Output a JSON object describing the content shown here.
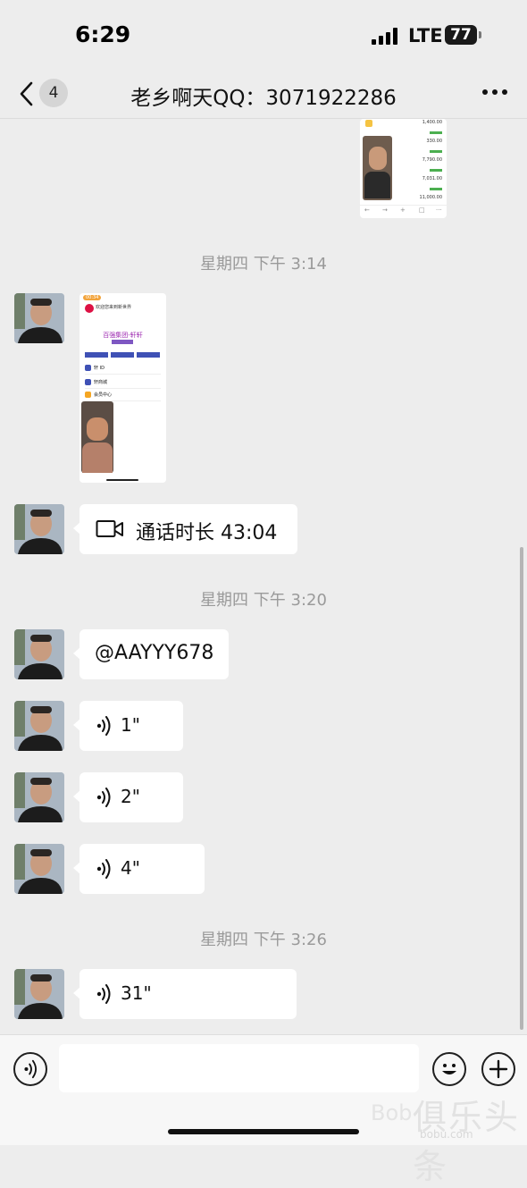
{
  "status_bar": {
    "time": "6:29",
    "network": "LTE",
    "battery": "77"
  },
  "nav": {
    "back_count": "4",
    "title": "老乡啊天QQ：3071922286"
  },
  "timestamps": [
    "星期四 下午 3:14",
    "星期四 下午 3:20",
    "星期四 下午 3:26"
  ],
  "messages": {
    "call": "通话时长 43:04",
    "mention": "@AAYYY678",
    "voice": [
      "1\"",
      "2\"",
      "4\"",
      "31\""
    ]
  },
  "shot1": {
    "amounts": [
      "1,400.00",
      "330.00",
      "7,790.00",
      "7,031.00",
      "11,000.00"
    ]
  },
  "shot2": {
    "pill": "00:34",
    "line1": "欢迎您来到新世界",
    "brand": "百强集团-轩轩",
    "rows": [
      "轩 ID",
      "轩商城",
      "会员中心"
    ]
  },
  "watermark": {
    "main": "俱乐头条",
    "sub": "Bob",
    "url": "bobu.com"
  },
  "colors": {
    "bubble": "#ffffff",
    "background": "#ededed",
    "timestamp": "#9a9a9a"
  }
}
